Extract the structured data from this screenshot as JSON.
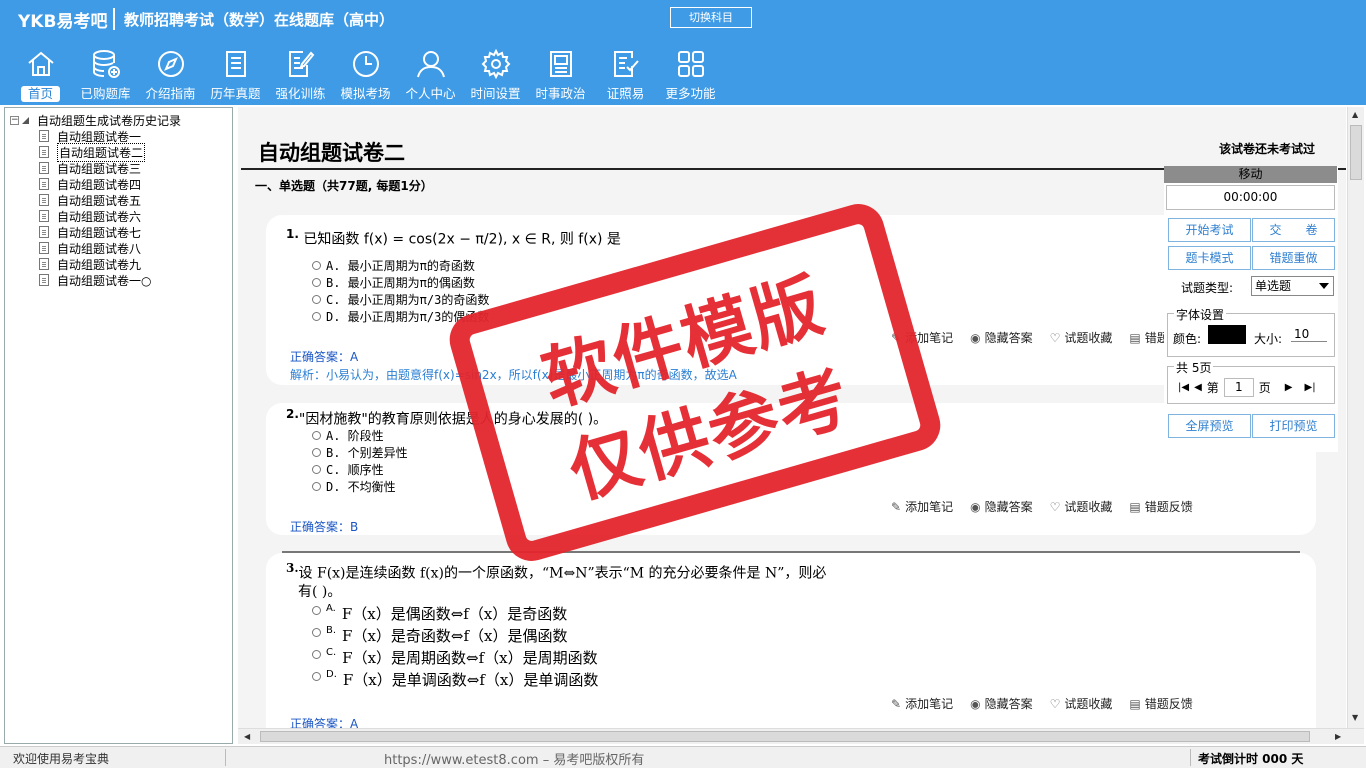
{
  "header": {
    "logo": "YKB易考吧",
    "title": "教师招聘考试（数学）在线题库（高中）",
    "switch_subject": "切换科目"
  },
  "nav": [
    {
      "label": "首页",
      "icon": "home-icon"
    },
    {
      "label": "已购题库",
      "icon": "database-icon"
    },
    {
      "label": "介绍指南",
      "icon": "compass-icon"
    },
    {
      "label": "历年真题",
      "icon": "list-doc-icon"
    },
    {
      "label": "强化训练",
      "icon": "edit-doc-icon"
    },
    {
      "label": "模拟考场",
      "icon": "clock-icon"
    },
    {
      "label": "个人中心",
      "icon": "user-icon"
    },
    {
      "label": "时间设置",
      "icon": "gear-icon"
    },
    {
      "label": "时事政治",
      "icon": "newspaper-icon"
    },
    {
      "label": "证照易",
      "icon": "checklist-icon"
    },
    {
      "label": "更多功能",
      "icon": "grid-icon"
    }
  ],
  "tree": {
    "root": "自动组题生成试卷历史记录",
    "items": [
      "自动组题试卷一",
      "自动组题试卷二",
      "自动组题试卷三",
      "自动组题试卷四",
      "自动组题试卷五",
      "自动组题试卷六",
      "自动组题试卷七",
      "自动组题试卷八",
      "自动组题试卷九",
      "自动组题试卷一○"
    ],
    "selected_index": 1
  },
  "paper": {
    "title": "自动组题试卷二",
    "status": "该试卷还未考试过",
    "section": "一、单选题（共77题, 每题1分）"
  },
  "questions": [
    {
      "num": "1.",
      "text": "已知函数 f(x) = cos(2x − π/2), x ∈ R, 则 f(x) 是",
      "options": [
        "A. 最小正周期为π的奇函数",
        "B. 最小正周期为π的偶函数",
        "C. 最小正周期为π/3的奇函数",
        "D. 最小正周期为π/3的偶函数"
      ],
      "answer": "正确答案：A",
      "explain": "解析：小易认为，由题意得f(x)=sin2x，所以f(x)是最小正周期为π的奇函数，故选A"
    },
    {
      "num": "2.",
      "text": "\"因材施教\"的教育原则依据是人的身心发展的(  )。",
      "options": [
        "A. 阶段性",
        "B. 个别差异性",
        "C. 顺序性",
        "D. 不均衡性"
      ],
      "answer": "正确答案：B"
    },
    {
      "num": "3.",
      "text_line1": "设 F(x)是连续函数 f(x)的一个原函数，“M⇔N”表示“M 的充分必要条件是 N”，则必",
      "text_line2": "有(   )。",
      "options": [
        {
          "label": "A.",
          "text": "F（x）是偶函数⇔f（x）是奇函数"
        },
        {
          "label": "B.",
          "text": "F（x）是奇函数⇔f（x）是偶函数"
        },
        {
          "label": "C.",
          "text": "F（x）是周期函数⇔f（x）是周期函数"
        },
        {
          "label": "D.",
          "text": "F（x）是单调函数⇔f（x）是单调函数"
        }
      ],
      "answer": "正确答案：A"
    }
  ],
  "actions": {
    "note": "添加笔记",
    "hide_answer": "隐藏答案",
    "favorite": "试题收藏",
    "feedback": "错题反馈"
  },
  "right_panel": {
    "move": "移动",
    "timer": "00:00:00",
    "start_exam": "开始考试",
    "submit": "交　　卷",
    "card_mode": "题卡模式",
    "redo_wrong": "错题重做",
    "qtype_label": "试题类型:",
    "qtype_value": "单选题",
    "font_legend": "字体设置",
    "color_label": "颜色:",
    "font_color": "#000000",
    "size_label": "大小:",
    "size_value": "10",
    "pages_legend": "共 5页",
    "page_prefix": "第",
    "page_value": "1",
    "page_suffix": "页",
    "fullscreen": "全屏预览",
    "print": "打印预览"
  },
  "status": {
    "welcome": "欢迎使用易考宝典",
    "url": "https://www.etest8.com – 易考吧版权所有",
    "countdown": "考试倒计时 000 天"
  },
  "watermark": {
    "line1": "软件模版",
    "line2": "仅供参考",
    "color": "#e3252c"
  },
  "colors": {
    "header_bg": "#3f9be6",
    "answer": "#1a56c4",
    "button_text": "#2e7fd0"
  }
}
